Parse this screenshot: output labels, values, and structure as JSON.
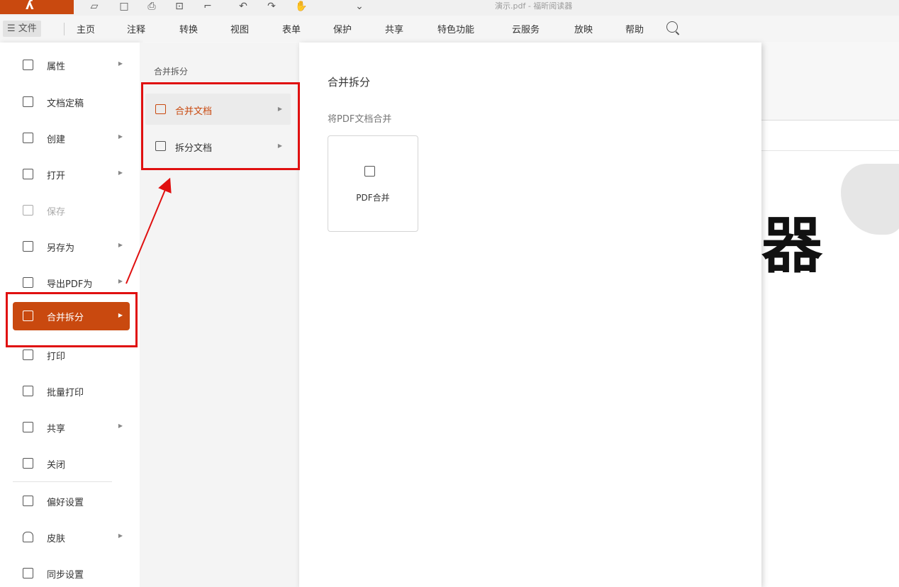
{
  "titlebar": {
    "title": "演示.pdf - 福昕阅读器"
  },
  "menubar": {
    "file_label": "☰ 文件",
    "items": [
      "主页",
      "注释",
      "转换",
      "视图",
      "表单",
      "保护",
      "共享",
      "特色功能",
      "云服务",
      "放映",
      "帮助"
    ]
  },
  "document": {
    "visible_text": "器"
  },
  "file_menu": {
    "items": [
      {
        "label": "属性"
      },
      {
        "label": "文档定稿"
      },
      {
        "label": "创建"
      },
      {
        "label": "打开"
      },
      {
        "label": "保存"
      },
      {
        "label": "另存为"
      },
      {
        "label": "导出PDF为"
      },
      {
        "label": "合并拆分"
      },
      {
        "label": "打印"
      },
      {
        "label": "批量打印"
      },
      {
        "label": "共享"
      },
      {
        "label": "关闭"
      },
      {
        "label": "偏好设置"
      },
      {
        "label": "皮肤"
      },
      {
        "label": "同步设置"
      }
    ]
  },
  "submenu": {
    "header": "合并拆分",
    "items": [
      {
        "label": "合并文档"
      },
      {
        "label": "拆分文档"
      }
    ]
  },
  "detail": {
    "title": "合并拆分",
    "subtitle": "将PDF文档合并",
    "card_label": "PDF合并"
  },
  "colors": {
    "accent": "#c9490f",
    "highlight": "#e01010"
  }
}
